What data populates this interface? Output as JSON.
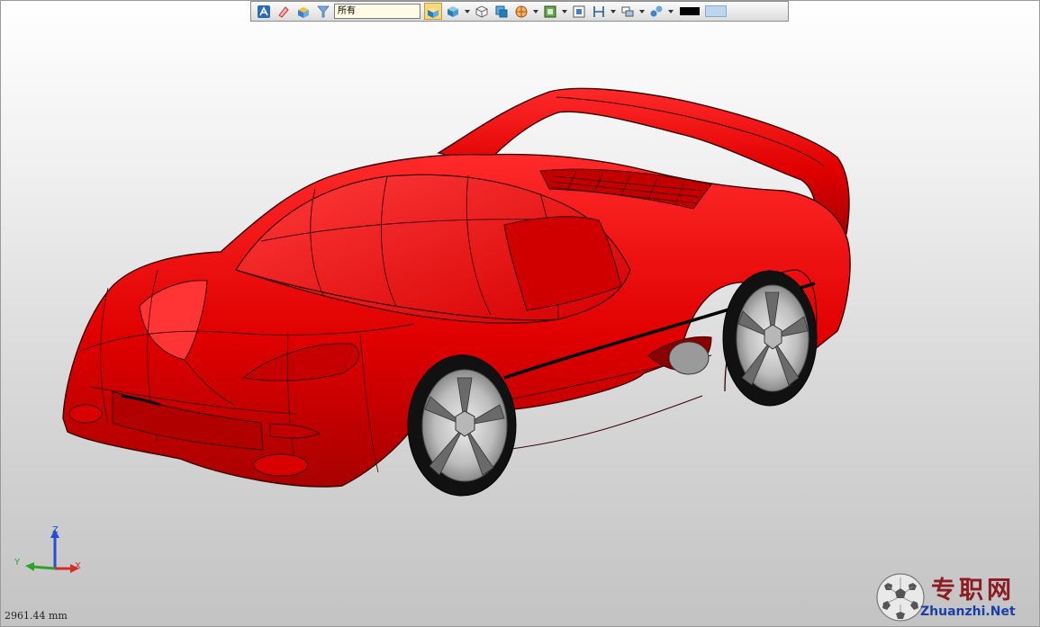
{
  "toolbar": {
    "filter_value": "所有",
    "buttons": [
      {
        "name": "select-icon"
      },
      {
        "name": "eraser-icon"
      },
      {
        "name": "box-icon"
      },
      {
        "name": "filter-icon"
      }
    ],
    "view_buttons": [
      {
        "name": "shaded-view-icon",
        "active": true,
        "dropdown": false
      },
      {
        "name": "iso-view-icon",
        "dropdown": true
      },
      {
        "name": "wire-box-icon",
        "dropdown": false
      },
      {
        "name": "section-view-icon",
        "dropdown": false
      },
      {
        "name": "render-mode-icon",
        "dropdown": true
      },
      {
        "name": "display-mode-icon",
        "dropdown": true
      },
      {
        "name": "zoom-fit-icon",
        "dropdown": false
      },
      {
        "name": "measure-icon",
        "dropdown": true
      },
      {
        "name": "layers-icon",
        "dropdown": true
      },
      {
        "name": "material-icon",
        "dropdown": true
      }
    ],
    "colors": {
      "line": "#000000",
      "background": "#bcd6ef"
    }
  },
  "triad": {
    "x_label": "X",
    "y_label": "Y",
    "z_label": "Z"
  },
  "scale_readout": "2961.44 mm",
  "watermark": {
    "title": "专职网",
    "url": "Zhuanzhi.Net"
  },
  "colors": {
    "car_body": "#e00000",
    "car_edge": "#3a0000"
  }
}
